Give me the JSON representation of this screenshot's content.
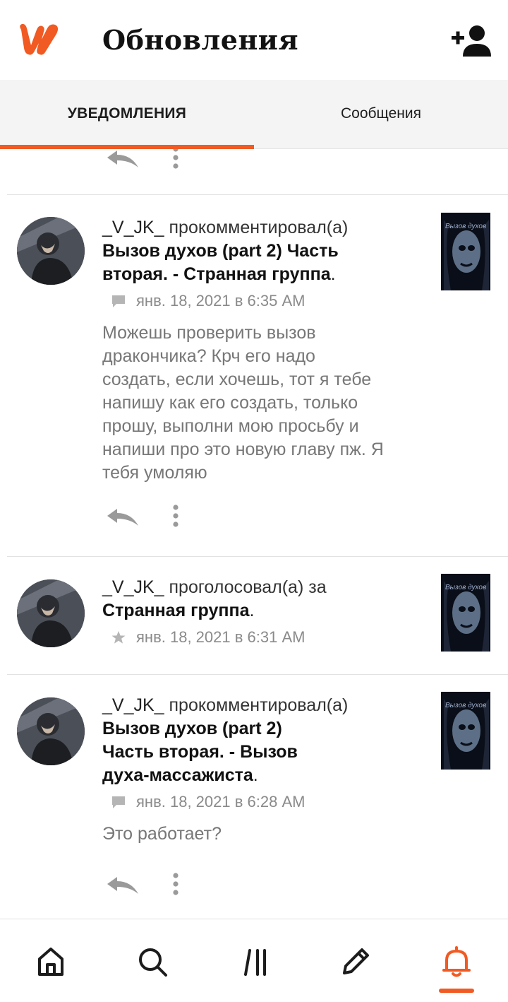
{
  "app": {
    "title": "Обновления",
    "accent_color": "#f15a22",
    "logo_icon": "wattpad-logo-icon",
    "add_user_icon": "add-user-icon"
  },
  "tabs": [
    {
      "label": "УВЕДОМЛЕНИЯ",
      "active": true
    },
    {
      "label": "Сообщения",
      "active": false
    }
  ],
  "notifications": [
    {
      "user": "_V_JK_",
      "action": "прокомментировал(а)",
      "story_lines": [
        "Вызов духов (part 2) Часть",
        "вторая. - Странная группа"
      ],
      "story_suffix": ".",
      "type_icon": "comment-icon",
      "timestamp": "янв. 18, 2021 в 6:35 AM",
      "comment_lines": [
        "Можешь проверить вызов",
        "дракончика? Крч его надо",
        "создать, если хочешь, тот я тебе",
        "напишу как его создать, только",
        "прошу, выполни мою просьбу и",
        "напиши про это новую главу пж. Я",
        "тебя умоляю"
      ],
      "cover_title": "Вызов духов"
    },
    {
      "user": "_V_JK_",
      "action": "проголосовал(а) за",
      "story_lines": [
        "Странная группа"
      ],
      "story_suffix": ".",
      "type_icon": "star-icon",
      "timestamp": "янв. 18, 2021 в 6:31 AM",
      "cover_title": "Вызов духов"
    },
    {
      "user": "_V_JK_",
      "action": "прокомментировал(а)",
      "story_lines": [
        "Вызов духов (part 2)",
        "Часть вторая. - Вызов",
        "духа-массажиста"
      ],
      "story_suffix": ".",
      "type_icon": "comment-icon",
      "timestamp": "янв. 18, 2021 в 6:28 AM",
      "comment_lines": [
        "Это работает?"
      ],
      "cover_title": "Вызов духов"
    }
  ],
  "bottom_nav": [
    {
      "icon": "home-icon",
      "active": false
    },
    {
      "icon": "search-icon",
      "active": false
    },
    {
      "icon": "library-icon",
      "active": false
    },
    {
      "icon": "pencil-icon",
      "active": false
    },
    {
      "icon": "bell-icon",
      "active": true
    }
  ]
}
